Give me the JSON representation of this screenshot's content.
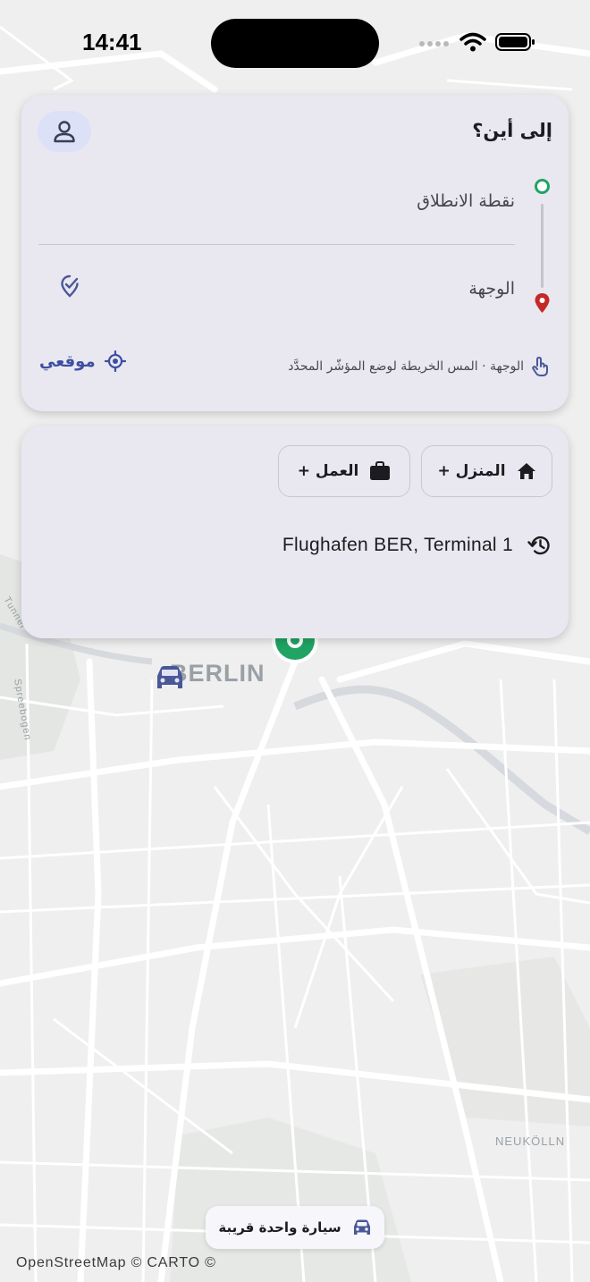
{
  "status_bar": {
    "time": "14:41"
  },
  "map": {
    "city_label": "BERLIN",
    "district_label": "NEUKÖLLN",
    "street_labels": [
      "Tunnel",
      "Spreebogen"
    ],
    "attribution": "OpenStreetMap © CARTO ©"
  },
  "search_card": {
    "title": "إلى أين؟",
    "origin_placeholder": "نقطة الانطلاق",
    "destination_placeholder": "الوجهة",
    "hint": "الوجهة · المس الخريطة لوضع المؤشّر المحدَّد",
    "my_location": "موقعي"
  },
  "quick_card": {
    "home_chip": "المنزل +",
    "work_chip": "العمل +",
    "recent": [
      "Flughafen BER, Terminal 1"
    ]
  },
  "nearby": {
    "label": "سيارة واحدة قريبة"
  },
  "icons": {
    "avatar": "person-icon",
    "origin": "origin-dot-icon",
    "destination": "location-pin-icon",
    "destination_action": "map-pin-check-icon",
    "hint": "touch-icon",
    "locate": "crosshair-icon",
    "home": "home-icon",
    "work": "briefcase-icon",
    "history": "history-icon",
    "car": "car-icon"
  },
  "colors": {
    "accent": "#3d4ea2",
    "origin_green": "#1fa463",
    "destination_red": "#c62828",
    "card_bg": "#e9e8f0"
  }
}
